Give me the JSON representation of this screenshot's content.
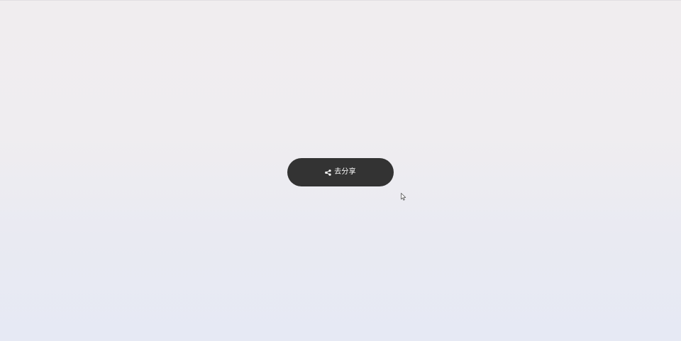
{
  "share_button": {
    "label": "去分享",
    "icon": "share-icon",
    "background_color": "#333333",
    "text_color": "#ffffff"
  },
  "background": {
    "top_color": "#f0edef",
    "bottom_color": "#e6e9f4"
  },
  "cursor": {
    "icon": "mouse-pointer-icon"
  }
}
